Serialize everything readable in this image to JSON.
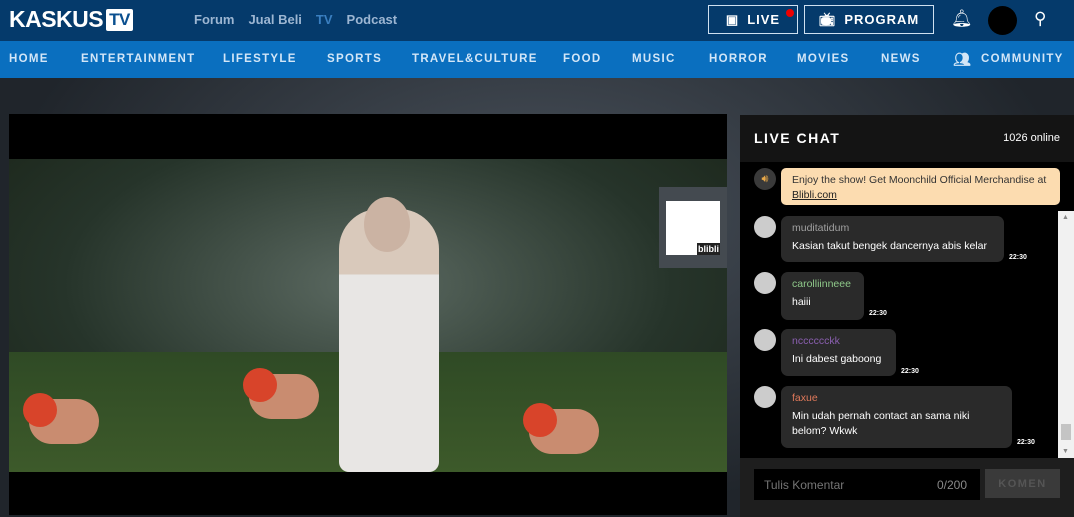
{
  "header": {
    "logo": "KASKUS",
    "logo_tv": "TV",
    "nav": [
      "Forum",
      "Jual Beli",
      "TV",
      "Podcast"
    ],
    "live_label": "LIVE",
    "program_label": "PROGRAM"
  },
  "categories": [
    "HOME",
    "ENTERTAINMENT",
    "LIFESTYLE",
    "SPORTS",
    "TRAVEL&CULTURE",
    "FOOD",
    "MUSIC",
    "HORROR",
    "MOVIES",
    "NEWS",
    "COMMUNITY"
  ],
  "player": {
    "banner_brand": "blibli"
  },
  "chat": {
    "title": "LIVE CHAT",
    "online": "1026 online",
    "announcement": {
      "text": "Enjoy the show! Get Moonchild Official Merchandise at ",
      "link": "Blibli.com"
    },
    "messages": [
      {
        "user": "muditatidum",
        "text": "Kasian takut bengek dancernya abis kelar",
        "time": "22:30",
        "color": "#a0a0a0"
      },
      {
        "user": "carolliinneee",
        "text": "haiii",
        "time": "22:30",
        "color": "#8fc98a"
      },
      {
        "user": "ncccccckk",
        "text": "Ini dabest gaboong",
        "time": "22:30",
        "color": "#8a5fb0"
      },
      {
        "user": "faxue",
        "text": "Min udah pernah contact an sama niki belom? Wkwk",
        "time": "22:30",
        "color": "#e0795a"
      }
    ],
    "input_placeholder": "Tulis Komentar",
    "char_count": "0/200",
    "submit_label": "KOMEN"
  }
}
